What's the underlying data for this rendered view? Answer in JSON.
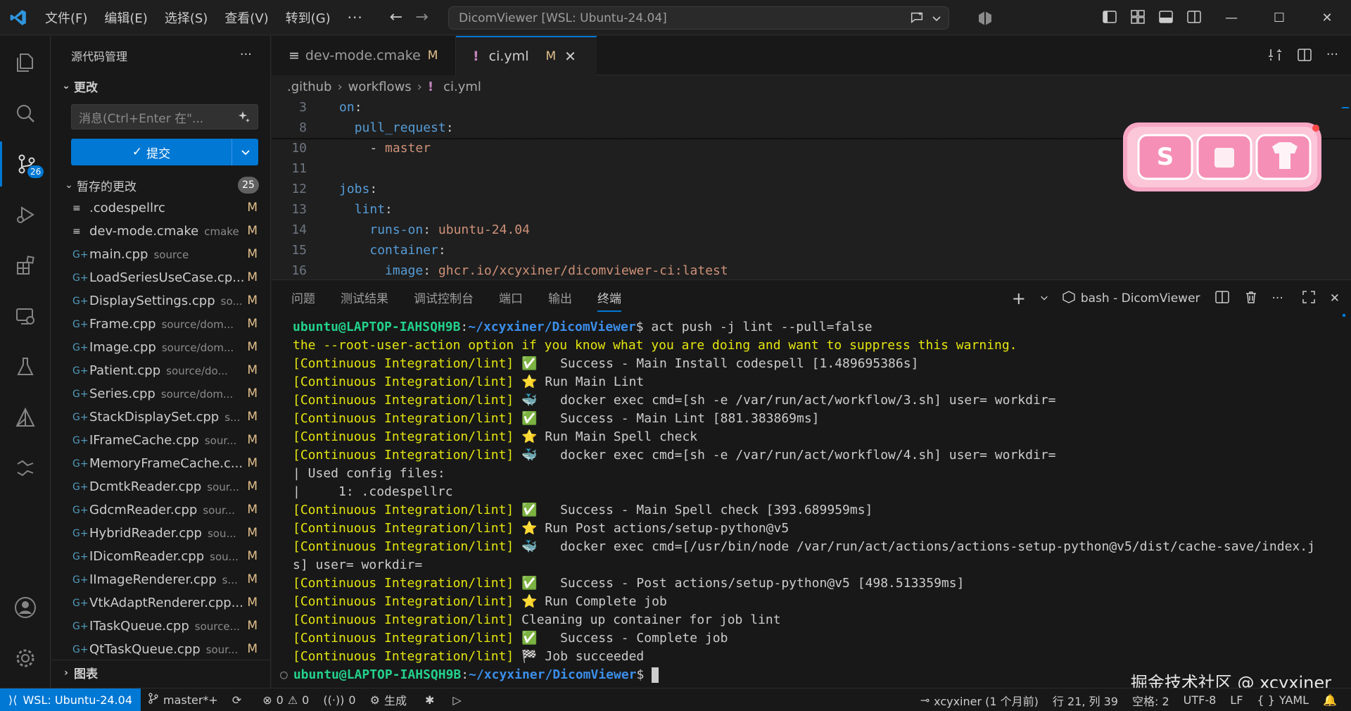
{
  "menu": [
    "文件(F)",
    "编辑(E)",
    "选择(S)",
    "查看(V)",
    "转到(G)"
  ],
  "menu_more": "···",
  "command_center": "DicomViewer [WSL: Ubuntu-24.04]",
  "sidebar": {
    "title": "源代码管理",
    "changes_label": "更改",
    "message_placeholder": "消息(Ctrl+Enter 在\"...",
    "commit_label": "提交",
    "staged_label": "暂存的更改",
    "staged_count": "25",
    "files": [
      {
        "icon": "text-file-icon",
        "name": ".codespellrc",
        "dir": "",
        "status": "M"
      },
      {
        "icon": "text-file-icon",
        "name": "dev-mode.cmake",
        "dir": "cmake",
        "status": "M"
      },
      {
        "icon": "cpp-file-icon",
        "name": "main.cpp",
        "dir": "source",
        "status": "M"
      },
      {
        "icon": "cpp-file-icon",
        "name": "LoadSeriesUseCase.cp...",
        "dir": "",
        "status": "M"
      },
      {
        "icon": "cpp-file-icon",
        "name": "DisplaySettings.cpp",
        "dir": "so...",
        "status": "M"
      },
      {
        "icon": "cpp-file-icon",
        "name": "Frame.cpp",
        "dir": "source/dom...",
        "status": "M"
      },
      {
        "icon": "cpp-file-icon",
        "name": "Image.cpp",
        "dir": "source/dom...",
        "status": "M"
      },
      {
        "icon": "cpp-file-icon",
        "name": "Patient.cpp",
        "dir": "source/do...",
        "status": "M"
      },
      {
        "icon": "cpp-file-icon",
        "name": "Series.cpp",
        "dir": "source/dom...",
        "status": "M"
      },
      {
        "icon": "cpp-file-icon",
        "name": "StackDisplaySet.cpp",
        "dir": "s...",
        "status": "M"
      },
      {
        "icon": "cpp-file-icon",
        "name": "IFrameCache.cpp",
        "dir": "sour...",
        "status": "M"
      },
      {
        "icon": "cpp-file-icon",
        "name": "MemoryFrameCache.c...",
        "dir": "",
        "status": "M"
      },
      {
        "icon": "cpp-file-icon",
        "name": "DcmtkReader.cpp",
        "dir": "sour...",
        "status": "M"
      },
      {
        "icon": "cpp-file-icon",
        "name": "GdcmReader.cpp",
        "dir": "sour...",
        "status": "M"
      },
      {
        "icon": "cpp-file-icon",
        "name": "HybridReader.cpp",
        "dir": "sou...",
        "status": "M"
      },
      {
        "icon": "cpp-file-icon",
        "name": "IDicomReader.cpp",
        "dir": "sou...",
        "status": "M"
      },
      {
        "icon": "cpp-file-icon",
        "name": "IImageRenderer.cpp",
        "dir": "s...",
        "status": "M"
      },
      {
        "icon": "cpp-file-icon",
        "name": "VtkAdaptRenderer.cpp...",
        "dir": "",
        "status": "M"
      },
      {
        "icon": "cpp-file-icon",
        "name": "ITaskQueue.cpp",
        "dir": "source...",
        "status": "M"
      },
      {
        "icon": "cpp-file-icon",
        "name": "QtTaskQueue.cpp",
        "dir": "sour...",
        "status": "M"
      }
    ],
    "graph_label": "图表"
  },
  "activity_badge": "26",
  "tabs": [
    {
      "name": "dev-mode.cmake",
      "mod": "M"
    },
    {
      "name": "ci.yml",
      "mod": "M"
    }
  ],
  "breadcrumb": [
    ".github",
    "workflows",
    "ci.yml"
  ],
  "code": [
    {
      "ln": "3",
      "indent": "",
      "parts": [
        [
          "k",
          "on"
        ],
        [
          "p",
          ":"
        ]
      ]
    },
    {
      "ln": "8",
      "indent": "  ",
      "parts": [
        [
          "k",
          "pull_request"
        ],
        [
          "p",
          ":"
        ]
      ]
    },
    {
      "ln": "10",
      "indent": "    ",
      "parts": [
        [
          "p",
          "- "
        ],
        [
          "s",
          "master"
        ]
      ]
    },
    {
      "ln": "11",
      "indent": "",
      "parts": []
    },
    {
      "ln": "12",
      "indent": "",
      "parts": [
        [
          "k",
          "jobs"
        ],
        [
          "p",
          ":"
        ]
      ]
    },
    {
      "ln": "13",
      "indent": "  ",
      "parts": [
        [
          "k",
          "lint"
        ],
        [
          "p",
          ":"
        ]
      ]
    },
    {
      "ln": "14",
      "indent": "    ",
      "parts": [
        [
          "k",
          "runs-on"
        ],
        [
          "p",
          ": "
        ],
        [
          "s",
          "ubuntu-24.04"
        ]
      ]
    },
    {
      "ln": "15",
      "indent": "    ",
      "parts": [
        [
          "k",
          "container"
        ],
        [
          "p",
          ":"
        ]
      ]
    },
    {
      "ln": "16",
      "indent": "      ",
      "parts": [
        [
          "k",
          "image"
        ],
        [
          "p",
          ": "
        ],
        [
          "s",
          "ghcr.io/xcyxiner/dicomviewer-ci:latest"
        ]
      ]
    }
  ],
  "panel": {
    "tabs": [
      "问题",
      "测试结果",
      "调试控制台",
      "端口",
      "输出",
      "终端"
    ],
    "active_tab": "终端",
    "terminal_name": "bash - DicomViewer"
  },
  "terminal": {
    "prompt_user": "ubuntu@LAPTOP-IAHSQH9B",
    "prompt_path": "~/xcyxiner/DicomViewer",
    "command": "act push -j lint --pull=false",
    "lines": [
      {
        "type": "warn",
        "text": "the --root-user-action option if you know what you are doing and want to suppress this warning."
      },
      {
        "type": "job",
        "prefix": "[Continuous Integration/lint]",
        "icon": "✅",
        "text": "  Success - Main Install codespell [1.489695386s]"
      },
      {
        "type": "job",
        "prefix": "[Continuous Integration/lint]",
        "icon": "⭐",
        "text": "Run Main Lint"
      },
      {
        "type": "job",
        "prefix": "[Continuous Integration/lint]",
        "icon": "🐳",
        "text": "  docker exec cmd=[sh -e /var/run/act/workflow/3.sh] user= workdir="
      },
      {
        "type": "job",
        "prefix": "[Continuous Integration/lint]",
        "icon": "✅",
        "text": "  Success - Main Lint [881.383869ms]"
      },
      {
        "type": "job",
        "prefix": "[Continuous Integration/lint]",
        "icon": "⭐",
        "text": "Run Main Spell check"
      },
      {
        "type": "job",
        "prefix": "[Continuous Integration/lint]",
        "icon": "🐳",
        "text": "  docker exec cmd=[sh -e /var/run/act/workflow/4.sh] user= workdir="
      },
      {
        "type": "plain",
        "text": "| Used config files:"
      },
      {
        "type": "plain",
        "text": "|     1: .codespellrc"
      },
      {
        "type": "job",
        "prefix": "[Continuous Integration/lint]",
        "icon": "✅",
        "text": "  Success - Main Spell check [393.689959ms]"
      },
      {
        "type": "job",
        "prefix": "[Continuous Integration/lint]",
        "icon": "⭐",
        "text": "Run Post actions/setup-python@v5"
      },
      {
        "type": "job",
        "prefix": "[Continuous Integration/lint]",
        "icon": "🐳",
        "text": "  docker exec cmd=[/usr/bin/node /var/run/act/actions/actions-setup-python@v5/dist/cache-save/index.j"
      },
      {
        "type": "plain",
        "text": "s] user= workdir="
      },
      {
        "type": "job",
        "prefix": "[Continuous Integration/lint]",
        "icon": "✅",
        "text": "  Success - Post actions/setup-python@v5 [498.513359ms]"
      },
      {
        "type": "job",
        "prefix": "[Continuous Integration/lint]",
        "icon": "⭐",
        "text": "Run Complete job"
      },
      {
        "type": "job",
        "prefix": "[Continuous Integration/lint]",
        "icon": "",
        "text": "Cleaning up container for job lint"
      },
      {
        "type": "job",
        "prefix": "[Continuous Integration/lint]",
        "icon": "✅",
        "text": "  Success - Complete job"
      },
      {
        "type": "job",
        "prefix": "[Continuous Integration/lint]",
        "icon": "🏁",
        "text": "Job succeeded"
      }
    ]
  },
  "watermark": "掘金技术社区 @ xcyxiner",
  "statusbar": {
    "remote": "WSL: Ubuntu-24.04",
    "branch": "master*+",
    "errors": "0",
    "warnings": "0",
    "ports": "0",
    "build": "生成",
    "blame": "xcyxiner (1 个月前)",
    "position": "行 21, 列 39",
    "spaces": "空格: 2",
    "encoding": "UTF-8",
    "eol": "LF",
    "language": "YAML"
  },
  "colors": {
    "accent": "#0078d4",
    "modified": "#e2c08d",
    "prompt_user": "#23d18b",
    "prompt_path": "#3b8eea",
    "warning": "#e5e510"
  }
}
